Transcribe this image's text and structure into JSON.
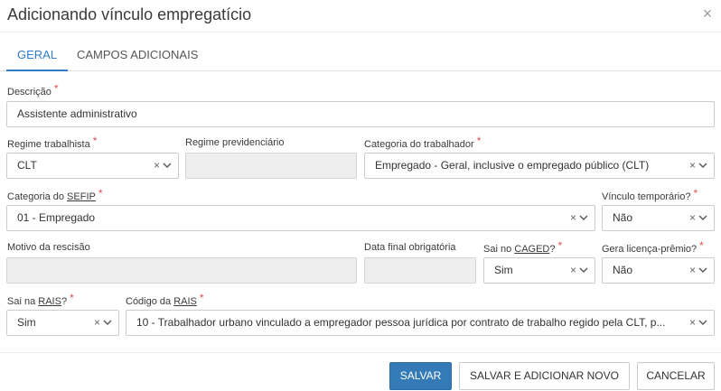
{
  "dialog": {
    "title": "Adicionando vínculo empregatício"
  },
  "tabs": [
    {
      "label": "GERAL",
      "active": true
    },
    {
      "label": "CAMPOS ADICIONAIS",
      "active": false
    }
  ],
  "form": {
    "descricao": {
      "label": "Descrição",
      "value": "Assistente administrativo",
      "required": true
    },
    "regime_trabalhista": {
      "label": "Regime trabalhista",
      "value": "CLT",
      "required": true
    },
    "regime_previdenciario": {
      "label": "Regime previdenciário",
      "value": ""
    },
    "categoria_trabalhador": {
      "label": "Categoria do trabalhador",
      "value": "Empregado - Geral, inclusive o empregado público (CLT)",
      "required": true
    },
    "categoria_sefip": {
      "label_prefix": "Categoria do ",
      "label_underlined": "SEFIP",
      "value": "01 - Empregado",
      "required": true
    },
    "vinculo_temporario": {
      "label": "Vínculo temporário?",
      "value": "Não",
      "required": true
    },
    "motivo_rescisao": {
      "label": "Motivo da rescisão",
      "value": ""
    },
    "data_final_obrigatoria": {
      "label": "Data final obrigatória",
      "value": ""
    },
    "sai_no_caged": {
      "label_prefix": "Sai no ",
      "label_underlined": "CAGED",
      "label_suffix": "?",
      "value": "Sim",
      "required": true
    },
    "gera_licenca_premio": {
      "label": "Gera licença-prêmio?",
      "value": "Não",
      "required": true
    },
    "sai_na_rais": {
      "label_prefix": "Sai na ",
      "label_underlined": "RAIS",
      "label_suffix": "?",
      "value": "Sim",
      "required": true
    },
    "codigo_rais": {
      "label_prefix": "Código da ",
      "label_underlined": "RAIS",
      "value": "10 - Trabalhador urbano vinculado a empregador pessoa jurídica por contrato de trabalho regido pela CLT, p...",
      "required": true
    }
  },
  "required_marker": "*",
  "clear_glyph": "×",
  "close_glyph": "×",
  "buttons": {
    "save": "SALVAR",
    "save_and_new": "SALVAR E ADICIONAR NOVO",
    "cancel": "CANCELAR"
  },
  "colors": {
    "primary": "#337ab7",
    "tab_active": "#2f7ccb",
    "required": "#d9534f",
    "disabled_bg": "#eeeeee"
  },
  "icons": [
    "close-icon",
    "clear-icon",
    "chevron-down-icon"
  ]
}
